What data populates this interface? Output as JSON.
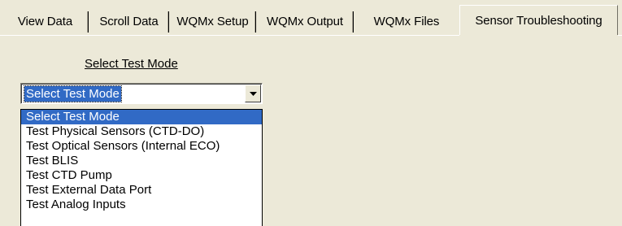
{
  "tabs": [
    {
      "label": "View Data",
      "active": false
    },
    {
      "label": "Scroll Data",
      "active": false
    },
    {
      "label": "WQMx Setup",
      "active": false
    },
    {
      "label": "WQMx Output",
      "active": false
    },
    {
      "label": "WQMx Files",
      "active": false
    },
    {
      "label": "Sensor Troubleshooting",
      "active": true
    }
  ],
  "test_mode": {
    "label": "Select Test Mode",
    "selected": "Select Test Mode",
    "options": [
      "Select Test Mode",
      "Test Physical Sensors (CTD-DO)",
      "Test Optical Sensors (Internal ECO)",
      "Test BLIS",
      "Test CTD Pump",
      "Test External Data Port",
      "Test Analog Inputs"
    ],
    "highlighted_index": 0
  },
  "icons": {
    "dropdown": "chevron-down-icon"
  },
  "colors": {
    "background": "#ece9d8",
    "highlight": "#316ac5"
  }
}
